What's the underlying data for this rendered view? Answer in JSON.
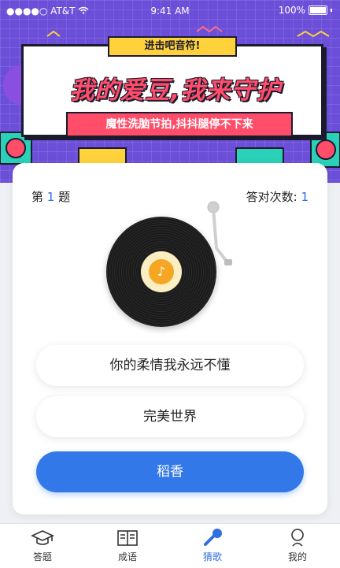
{
  "status_bar": {
    "carrier": "●●●●○ AT&T",
    "time": "9:41 AM",
    "battery": "100%"
  },
  "banner": {
    "tag": "进击吧音符!",
    "slogan": "我的爱豆,我来守护",
    "subtitle": "魔性洗脑节拍,抖抖腿停不下来"
  },
  "quiz": {
    "question_prefix": "第",
    "question_number": "1",
    "question_suffix": "题",
    "score_label": "答对次数:",
    "score_value": "1",
    "options": [
      "你的柔情我永远不懂",
      "完美世界",
      "稻香"
    ]
  },
  "tabs": [
    {
      "label": "答题",
      "icon": "graduation-cap-icon"
    },
    {
      "label": "成语",
      "icon": "book-icon"
    },
    {
      "label": "猜歌",
      "icon": "microphone-icon"
    },
    {
      "label": "我的",
      "icon": "user-icon"
    }
  ],
  "colors": {
    "accent": "#2f6fe0",
    "banner_bg": "#6b4fd8",
    "pink": "#ff4d6a",
    "yellow": "#ffd23c"
  }
}
